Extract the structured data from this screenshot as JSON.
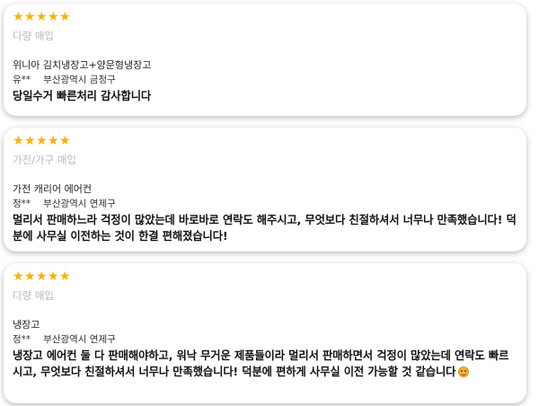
{
  "reviews": [
    {
      "rating": 5,
      "category": "다량 매입",
      "product": "위니아 김치냉장고+양문형냉장고",
      "reviewer": "유**",
      "region": "부산광역시 금정구",
      "comment": "당일수거 빠른처리 감사합니다",
      "emoji": ""
    },
    {
      "rating": 5,
      "category": "가전/가구 매입",
      "product": "가전 캐리어 에어컨",
      "reviewer": "정**",
      "region": "부산광역시 연제구",
      "comment": "멀리서 판매하느라 걱정이 많았는데 바로바로 연락도 해주시고, 무엇보다 친절하셔서 너무나 만족했습니다! 덕분에 사무실 이전하는 것이 한결 편해졌습니다!",
      "emoji": ""
    },
    {
      "rating": 5,
      "category": "다량 매입",
      "product": "냉장고",
      "reviewer": "정**",
      "region": "부산광역시 연제구",
      "comment": "냉장고 에어컨 둘 다 판매해야하고, 워낙 무거운 제품들이라 멀리서 판매하면서 걱정이 많았는데 연락도 빠르시고, 무엇보다 친절하셔서 너무나 만족했습니다! 덕분에 편하게 사무실 이전 가능할 것 같습니다",
      "emoji": "smiling-face-emoji"
    }
  ],
  "star_glyph": "★",
  "star_color": "#f5b400"
}
